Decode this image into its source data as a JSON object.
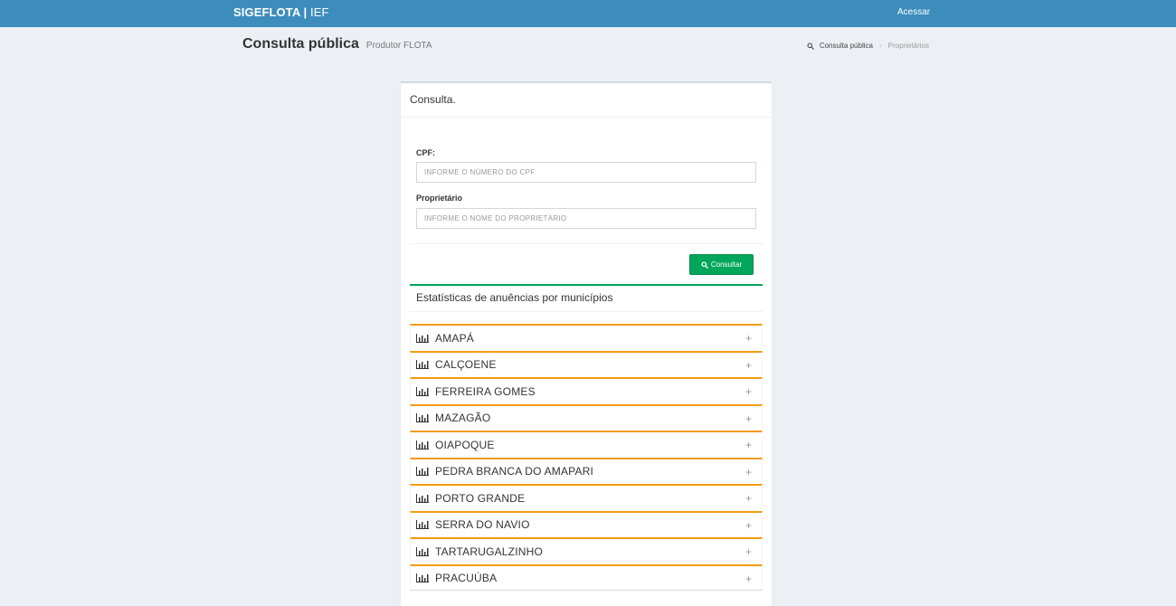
{
  "topbar": {
    "brand_bold": "SIGEFLOTA |",
    "brand_thin": " IEF",
    "login": "Acessar",
    "bg_color": "#3c8dbc"
  },
  "header": {
    "title": "Consulta pública",
    "subtitle": "Produtor FLOTA"
  },
  "breadcrumb": {
    "icon": "search-icon",
    "items": [
      "Consulta pública",
      "Proprietários"
    ]
  },
  "panel": {
    "title": "Consulta.",
    "cpf": {
      "label": "CPF:",
      "placeholder": "INFORME O NÚMERO DO CPF",
      "value": ""
    },
    "owner": {
      "label": "Proprietário",
      "placeholder": "INFORME O NOME DO PROPRIETÁRIO",
      "value": ""
    },
    "submit_label": "Consultar",
    "submit_color": "#00a65a"
  },
  "stats": {
    "title": "Estatísticas de anuências por municípios",
    "accent_color": "#f39c12",
    "municipalities": [
      "AMAPÁ",
      "CALÇOENE",
      "FERREIRA GOMES",
      "MAZAGÃO",
      "OIAPOQUE",
      "PEDRA BRANCA DO AMAPARI",
      "PORTO GRANDE",
      "SERRA DO NAVIO",
      "TARTARUGALZINHO",
      "PRACUÚBA"
    ],
    "expand_icon": "plus-icon",
    "row_icon": "bar-chart-icon"
  }
}
